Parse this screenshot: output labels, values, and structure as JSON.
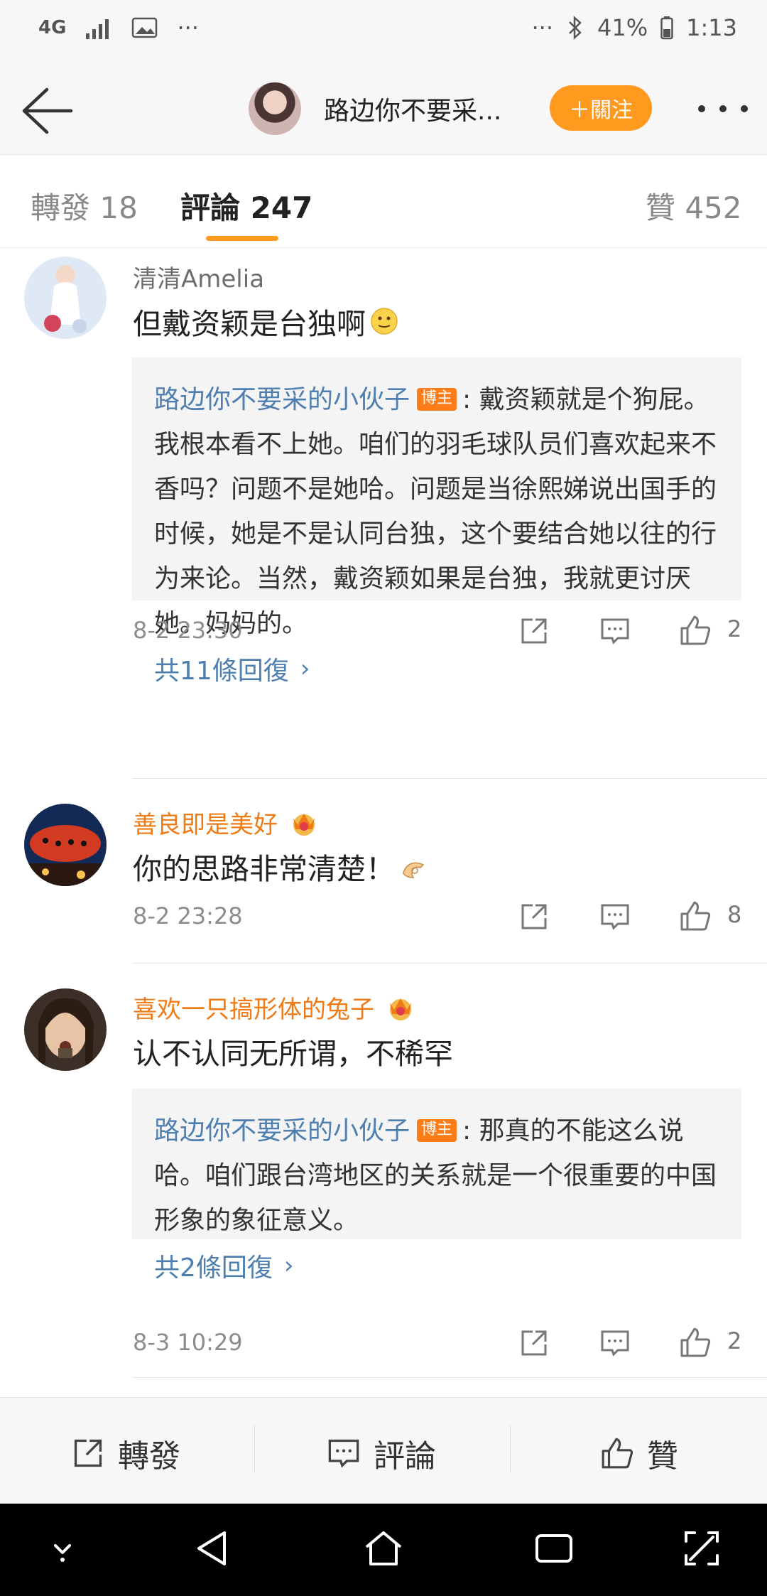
{
  "status_bar": {
    "network": "4G",
    "ellipsis_left": "···",
    "ellipsis_right": "···",
    "battery": "41%",
    "time": "1:13"
  },
  "header": {
    "author_name": "路边你不要采...",
    "follow_label": "＋關注"
  },
  "tabs": [
    {
      "label": "轉發 18"
    },
    {
      "label": "評論 247"
    },
    {
      "label": "贊 452"
    }
  ],
  "comments": [
    {
      "user": "清清Amelia",
      "text": "但戴资颖是台独啊",
      "reply": {
        "author": "路边你不要采的小伙子",
        "badge": "博主",
        "text": ": 戴资颖就是个狗屁。我根本看不上她。咱们的羽毛球队员们喜欢起来不香吗？问题不是她哈。问题是当徐熙娣说出国手的时候，她是不是认同台独，这个要结合她以往的行为来论。当然，戴资颖如果是台独，我就更讨厌她。妈妈的。",
        "more": "共11條回復"
      },
      "time": "8-2 23:30",
      "likes": "2"
    },
    {
      "user": "善良即是美好",
      "text": "你的思路非常清楚！",
      "time": "8-2 23:28",
      "likes": "8"
    },
    {
      "user": "喜欢一只搞形体的兔子",
      "text": "认不认同无所谓，不稀罕",
      "reply": {
        "author": "路边你不要采的小伙子",
        "badge": "博主",
        "text": ": 那真的不能这么说哈。咱们跟台湾地区的关系就是一个很重要的中国形象的象征意义。",
        "more": "共2條回復"
      },
      "time": "8-3 10:29",
      "likes": "2"
    }
  ],
  "bottom_bar": {
    "share": "轉發",
    "comment": "評論",
    "like": "贊"
  },
  "colors": {
    "accent": "#ff9a1e",
    "link": "#4e7fb0",
    "vip_name": "#f07a15"
  }
}
